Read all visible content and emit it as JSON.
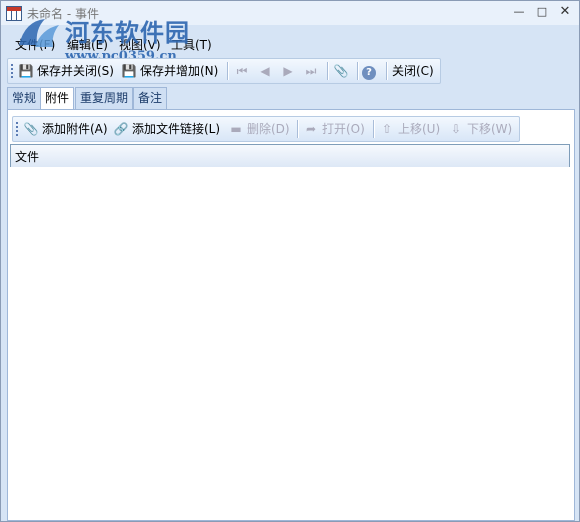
{
  "window": {
    "title": "未命名 - 事件"
  },
  "watermark": {
    "text": "河东软件园",
    "url": "www.pc0359.cn"
  },
  "menu": [
    {
      "label": "文件(F)"
    },
    {
      "label": "编辑(E)"
    },
    {
      "label": "视图(V)"
    },
    {
      "label": "工具(T)"
    }
  ],
  "toolbar": {
    "save_close": "保存并关闭(S)",
    "save_add": "保存并增加(N)",
    "close": "关闭(C)"
  },
  "tabs": [
    {
      "label": "常规"
    },
    {
      "label": "附件",
      "active": true
    },
    {
      "label": "重复周期"
    },
    {
      "label": "备注"
    }
  ],
  "attach_toolbar": {
    "add_attachment": "添加附件(A)",
    "add_file_link": "添加文件链接(L)",
    "delete": "删除(D)",
    "open": "打开(O)",
    "move_up": "上移(U)",
    "move_down": "下移(W)"
  },
  "list": {
    "column_file": "文件"
  },
  "colors": {
    "accent": "#2d66b0",
    "frame": "#d6e4f5"
  }
}
